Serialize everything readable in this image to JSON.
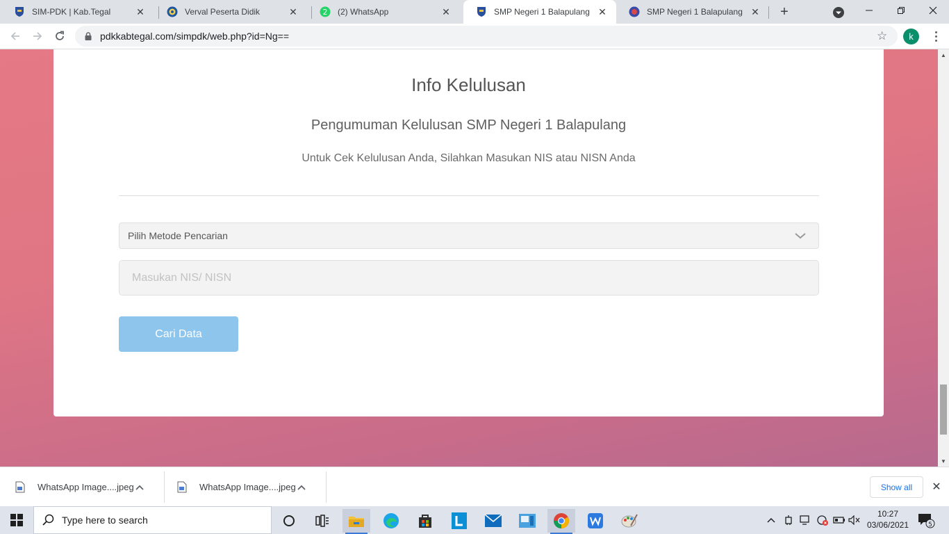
{
  "browser": {
    "tabs": [
      {
        "title": "SIM-PDK | Kab.Tegal",
        "active": false
      },
      {
        "title": "Verval Peserta Didik",
        "active": false
      },
      {
        "title": "(2) WhatsApp",
        "active": false,
        "badge": "2"
      },
      {
        "title": "SMP Negeri 1 Balapulang",
        "active": true
      },
      {
        "title": "SMP Negeri 1 Balapulang",
        "active": false
      }
    ],
    "new_tab_label": "+",
    "url": "pdkkabtegal.com/simpdk/web.php?id=Ng==",
    "profile_initial": "k"
  },
  "page": {
    "title": "Info Kelulusan",
    "subtitle": "Pengumuman Kelulusan SMP Negeri 1 Balapulang",
    "instruction": "Untuk Cek Kelulusan Anda, Silahkan Masukan NIS atau NISN Anda",
    "search_method": {
      "selected": "Pilih Metode Pencarian"
    },
    "id_input": {
      "value": "",
      "placeholder": "Masukan NIS/ NISN"
    },
    "submit_label": "Cari Data",
    "background_colors": [
      "#e57985",
      "#b66a8e"
    ],
    "button_color": "#8ec5ec"
  },
  "downloads": {
    "items": [
      {
        "name": "WhatsApp Image....jpeg"
      },
      {
        "name": "WhatsApp Image....jpeg"
      }
    ],
    "show_all_label": "Show all"
  },
  "taskbar": {
    "search_placeholder": "Type here to search",
    "time": "10:27",
    "date": "03/06/2021",
    "notification_count": "5",
    "apps": [
      "cortana-icon",
      "task-view-icon",
      "file-explorer-icon",
      "edge-icon",
      "store-icon",
      "l-app-icon",
      "mail-icon",
      "remote-desktop-icon",
      "chrome-icon",
      "wps-icon",
      "paint-icon"
    ]
  }
}
